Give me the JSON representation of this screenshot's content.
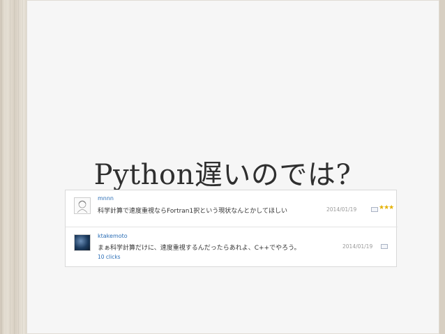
{
  "slide": {
    "title": "Python遅いのでは?"
  },
  "comments": [
    {
      "username": "mnnn",
      "text": "科学計算で速度重視ならFortran1択という現状なんとかしてほしい",
      "date": "2014/01/19",
      "stars": "★★★"
    },
    {
      "username": "ktakemoto",
      "text": "まぁ科学計算だけに、速度重視するんだったらあれよ、C++でやろう。",
      "date": "2014/01/19",
      "clicks": "10 clicks"
    }
  ]
}
